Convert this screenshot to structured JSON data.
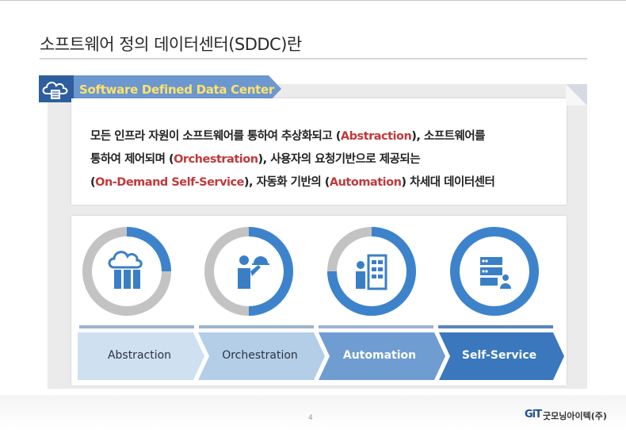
{
  "slide": {
    "title": "소프트웨어 정의 데이터센터(SDDC)란",
    "banner_title": "Software Defined Data Center",
    "definition": {
      "line1": [
        {
          "text": "모든 인프라 자원이 소프트웨어를 통하여 추상화되고 (",
          "highlight": false
        },
        {
          "text": "Abstraction",
          "highlight": true
        },
        {
          "text": "), 소프트웨어를",
          "highlight": false
        }
      ],
      "line2": [
        {
          "text": "통하여 제어되며 (",
          "highlight": false
        },
        {
          "text": "Orchestration",
          "highlight": true
        },
        {
          "text": "), 사용자의 요청기반으로 제공되는",
          "highlight": false
        }
      ],
      "line3": [
        {
          "text": "(",
          "highlight": false
        },
        {
          "text": "On-Demand Self-Service",
          "highlight": true
        },
        {
          "text": "),  자동화 기반의 (",
          "highlight": false
        },
        {
          "text": "Automation",
          "highlight": true
        },
        {
          "text": ") 차세대 데이터센터",
          "highlight": false
        }
      ]
    },
    "steps": [
      {
        "label": "Abstraction",
        "icon": "cloud-server-icon",
        "progress": 0.25
      },
      {
        "label": "Orchestration",
        "icon": "waiter-service-icon",
        "progress": 0.5
      },
      {
        "label": "Automation",
        "icon": "control-panel-operator-icon",
        "progress": 0.75
      },
      {
        "label": "Self-Service",
        "icon": "server-user-icon",
        "progress": 1.0
      }
    ],
    "page_number": "4",
    "company": {
      "logo_text": "GiT",
      "name": "굿모닝아이텍(주)"
    }
  },
  "colors": {
    "accent_blue": "#3d83cc",
    "ring_grey": "#c3c3c3",
    "highlight_red": "#c0393b",
    "banner_text": "#ffe36a",
    "arrow_1": "#cfe0f1",
    "arrow_2": "#b4cee8",
    "arrow_3": "#6f9dd1",
    "arrow_4": "#3b77bd"
  }
}
